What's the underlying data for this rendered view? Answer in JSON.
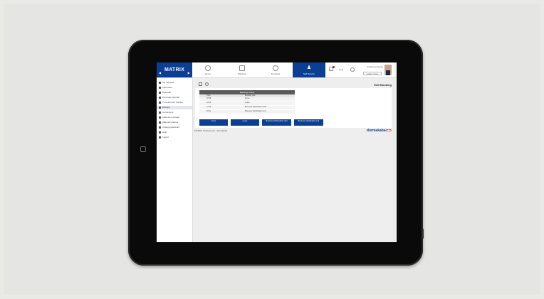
{
  "app": {
    "logo": "MATRIX",
    "page_title": "Edit Booking",
    "footer_text": "MATRIX Professional - dormakaba",
    "brand": "dormakaba",
    "brand_suffix": "⊂⊃"
  },
  "topnav": {
    "items": [
      {
        "label": "Home"
      },
      {
        "label": "Windows"
      },
      {
        "label": "Favorites"
      }
    ],
    "active": {
      "label": "Self Service"
    },
    "status_text": "Help",
    "user": "Employee Name",
    "logout": "Logout / Close"
  },
  "sidebar": {
    "items": [
      {
        "label": "My requests"
      },
      {
        "label": "Approvals"
      },
      {
        "label": "Calendar"
      },
      {
        "label": "Personal calendar"
      },
      {
        "label": "Time account request"
      },
      {
        "label": "Booking"
      },
      {
        "label": "Corrections"
      },
      {
        "label": "Absence manager"
      },
      {
        "label": "Absence planner"
      },
      {
        "label": "Change password"
      },
      {
        "label": "Help"
      },
      {
        "label": "Logout"
      }
    ],
    "active_index": 5
  },
  "bookings_table": {
    "title": "Bookings today",
    "columns": [
      "Time",
      "Booking type"
    ],
    "rows": [
      {
        "time": "07:58",
        "type": "Come"
      },
      {
        "time": "12:02",
        "type": "Leave"
      },
      {
        "time": "12:44",
        "type": "Business trip/Vacation start"
      },
      {
        "time": "16:11",
        "type": "Business trip/Vacation end"
      }
    ]
  },
  "buttons": [
    {
      "label": "Come"
    },
    {
      "label": "Leave"
    },
    {
      "label": "Business trip/Vacation start"
    },
    {
      "label": "Business trip/Vacation end"
    }
  ],
  "colors": {
    "accent": "#0b3f94",
    "brand_red": "#d6001c",
    "background": "#e9e9e5",
    "device": "#0a0a0a"
  }
}
